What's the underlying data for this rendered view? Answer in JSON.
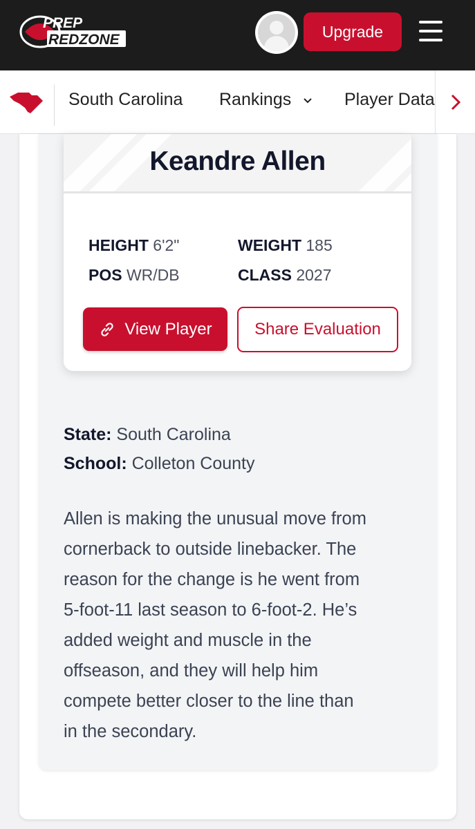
{
  "header": {
    "logo_line1": "PREP",
    "logo_line2": "REDZONE",
    "upgrade_label": "Upgrade"
  },
  "nav": {
    "items": [
      {
        "label": "South Carolina"
      },
      {
        "label": "Rankings",
        "has_dropdown": true
      },
      {
        "label": "Player Data"
      }
    ]
  },
  "player": {
    "name": "Keandre Allen",
    "height_label": "HEIGHT",
    "height": "6'2\"",
    "weight_label": "WEIGHT",
    "weight": "185",
    "pos_label": "POS",
    "pos": "WR/DB",
    "class_label": "CLASS",
    "class": "2027",
    "view_button": "View Player",
    "share_button": "Share Evaluation"
  },
  "details": {
    "state_label": "State:",
    "state": "South Carolina",
    "school_label": "School:",
    "school": "Colleton County"
  },
  "evaluation": {
    "lines": [
      "Allen is making the unusual move from",
      "cornerback to outside linebacker. The",
      "reason for the change is he went from",
      "5-foot-11 last season to 6-foot-2. He’s",
      "added weight and muscle in the",
      "offseason, and they will help him",
      "compete better closer to the line than",
      "in the secondary."
    ]
  },
  "colors": {
    "brand_red": "#c8102e",
    "header_bg": "#1c1c1c",
    "text_dark": "#13172b"
  }
}
